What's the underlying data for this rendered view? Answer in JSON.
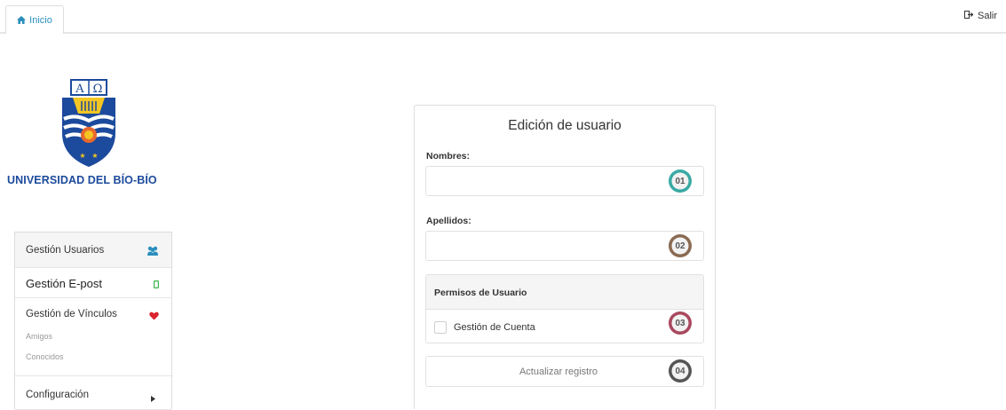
{
  "nav": {
    "home_label": "Inicio",
    "logout_label": "Salir"
  },
  "logo": {
    "university_name": "UNIVERSIDAD DEL BÍO-BÍO",
    "shield_text": "AΩ"
  },
  "sidebar": {
    "items": [
      {
        "label": "Gestión Usuarios",
        "icon": "users-icon"
      },
      {
        "label": "Gestión E-post",
        "icon": "mobile-icon"
      },
      {
        "label": "Gestión de Vínculos",
        "icon": "heart-icon",
        "subitems": [
          "Amigos",
          "Conocidos"
        ]
      },
      {
        "label": "Configuración",
        "icon": "caret-right-icon"
      }
    ]
  },
  "form": {
    "title": "Edición de usuario",
    "nombres_label": "Nombres:",
    "nombres_value": "",
    "apellidos_label": "Apellidos:",
    "apellidos_value": "",
    "permissions_title": "Permisos de Usuario",
    "permission_option": "Gestión de Cuenta",
    "permission_checked": false,
    "submit_label": "Actualizar registro"
  },
  "callouts": [
    {
      "number": "01",
      "color": "#3aa9a4"
    },
    {
      "number": "02",
      "color": "#8a6a52"
    },
    {
      "number": "03",
      "color": "#a8485e"
    },
    {
      "number": "04",
      "color": "#555555"
    }
  ],
  "colors": {
    "link": "#2a8fbd",
    "brand_blue": "#1c4a9c",
    "heart": "#d9232e",
    "users_icon": "#2a8fbd",
    "mobile_icon": "#3cb64a"
  }
}
